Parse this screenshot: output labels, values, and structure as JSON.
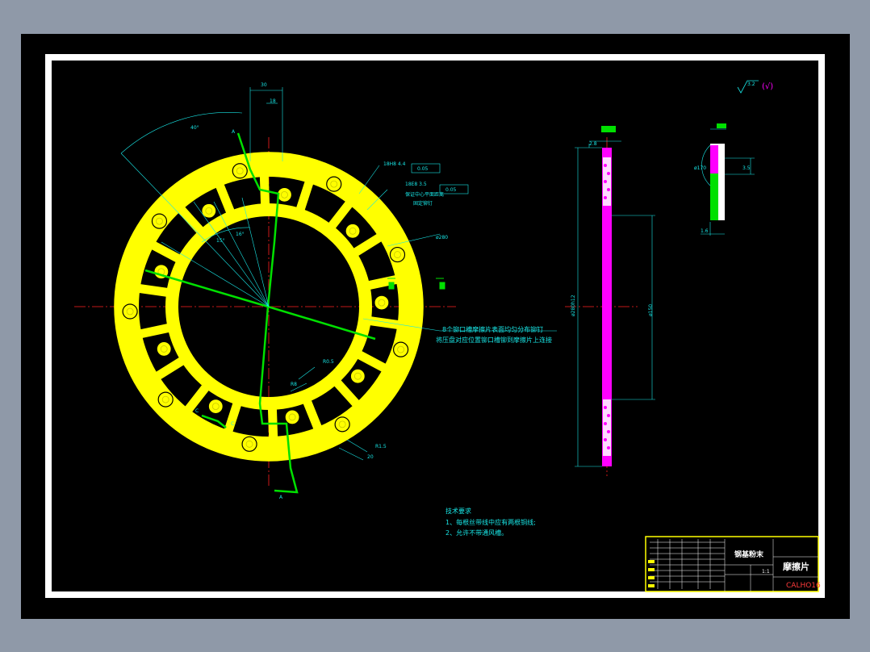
{
  "drawing": {
    "tech_requirements": {
      "heading": "技术要求",
      "items": [
        "1、每根丝带线中应有两根铜线;",
        "2、允许不带通风槽。"
      ]
    },
    "note_rivet": "8个铆口槽摩擦片表面均匀分布铆钉",
    "note_rivet_2": "将压盘对应位置铆口槽铆到摩擦片上连接",
    "roughness": "(√)",
    "roughness_value": "3.2",
    "section_labels": [
      "A",
      "A",
      "C",
      "C"
    ],
    "dimensions": [
      "30",
      "18",
      "40°",
      "15°",
      "16°",
      "R0.5",
      "R1.5",
      "R8",
      "20",
      "2.8",
      "3.5",
      "1.6",
      "ø280",
      "ø170",
      "ø280h12",
      "ø150"
    ],
    "tolerance_notes": [
      "18H8 4.4",
      "0.05",
      "18E8 3.5",
      "0.05",
      "保证中心平面距离",
      "固定铆钉"
    ]
  },
  "title_block": {
    "material": "钢基粉末",
    "part_name": "摩擦片",
    "code": "CALHO16",
    "scale_label": "1:1"
  },
  "colors": {
    "part": "#ffff00",
    "section_lines": "#00e000",
    "side_view": "#ff00ff",
    "dimension": "#18e6e6",
    "center_line": "#ff2020"
  }
}
